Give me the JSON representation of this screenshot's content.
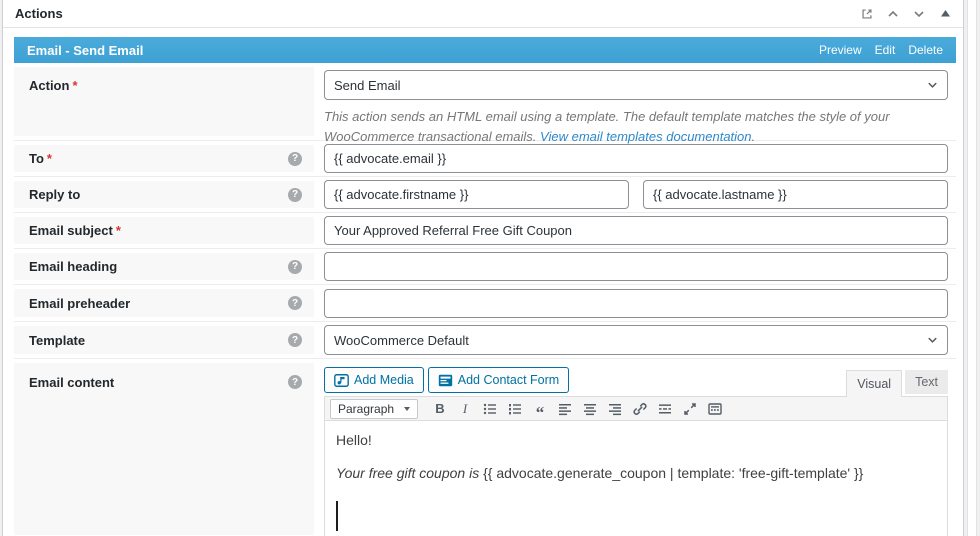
{
  "metabox_header": {
    "title": "Actions"
  },
  "action_panel": {
    "title": "Email - Send Email",
    "links": {
      "preview": "Preview",
      "edit": "Edit",
      "delete": "Delete"
    }
  },
  "fields": {
    "action": {
      "label": "Action",
      "required_mark": "*",
      "value": "Send Email",
      "description": "This action sends an HTML email using a template. The default template matches the style of your WooCommerce transactional emails.",
      "description_link": "View email templates documentation",
      "description_period": "."
    },
    "to": {
      "label": "To",
      "required_mark": "*",
      "value": "{{ advocate.email }}",
      "help_glyph": "?"
    },
    "reply_to": {
      "label": "Reply to",
      "first_value": "{{ advocate.firstname }}",
      "last_value": "{{ advocate.lastname }}",
      "help_glyph": "?"
    },
    "email_subject": {
      "label": "Email subject",
      "required_mark": "*",
      "value": "Your Approved Referral Free Gift Coupon"
    },
    "email_heading": {
      "label": "Email heading",
      "value": "",
      "help_glyph": "?"
    },
    "email_preheader": {
      "label": "Email preheader",
      "value": "",
      "help_glyph": "?"
    },
    "template": {
      "label": "Template",
      "value": "WooCommerce Default",
      "help_glyph": "?"
    },
    "email_content": {
      "label": "Email content",
      "help_glyph": "?"
    }
  },
  "editor": {
    "add_media_label": "Add Media",
    "add_contact_form_label": "Add Contact Form",
    "visual_tab": "Visual",
    "text_tab": "Text",
    "format_select_value": "Paragraph",
    "bold_glyph": "B",
    "italic_glyph": "I",
    "blockquote_glyph": "“",
    "content": {
      "line1": "Hello!",
      "line2_italic": "Your free gift coupon is ",
      "line2_plain": "{{ advocate.generate_coupon | template: 'free-gift-template' }}"
    }
  },
  "colors": {
    "panel_blue": "#44a6d8",
    "link_blue": "#2e87c9",
    "button_blue": "#0071a1",
    "required_red": "#d63638",
    "label_bg": "#f8f8f8"
  }
}
